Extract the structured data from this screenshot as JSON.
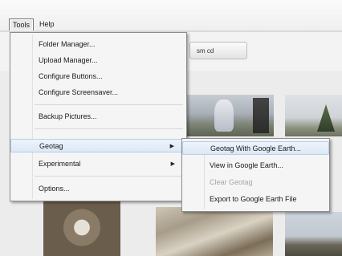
{
  "menubar": {
    "tools": "Tools",
    "help": "Help"
  },
  "toolbar": {
    "button_label": "sm cd"
  },
  "tools_menu": {
    "items": [
      {
        "label": "Folder Manager..."
      },
      {
        "label": "Upload Manager..."
      },
      {
        "label": "Configure Buttons..."
      },
      {
        "label": "Configure Screensaver..."
      },
      {
        "label": "Backup Pictures..."
      },
      {
        "label": "Geotag"
      },
      {
        "label": "Experimental"
      },
      {
        "label": "Options..."
      }
    ]
  },
  "geotag_menu": {
    "items": [
      {
        "label": "Geotag With Google Earth..."
      },
      {
        "label": "View in Google Earth..."
      },
      {
        "label": "Clear Geotag"
      },
      {
        "label": "Export to Google Earth File"
      }
    ]
  },
  "icons": {
    "submenu_arrow": "submenu-arrow-icon"
  },
  "colors": {
    "highlight": "#dce8f6",
    "menu_bg": "#f5f5f5",
    "disabled_text": "#a6a6a6"
  }
}
